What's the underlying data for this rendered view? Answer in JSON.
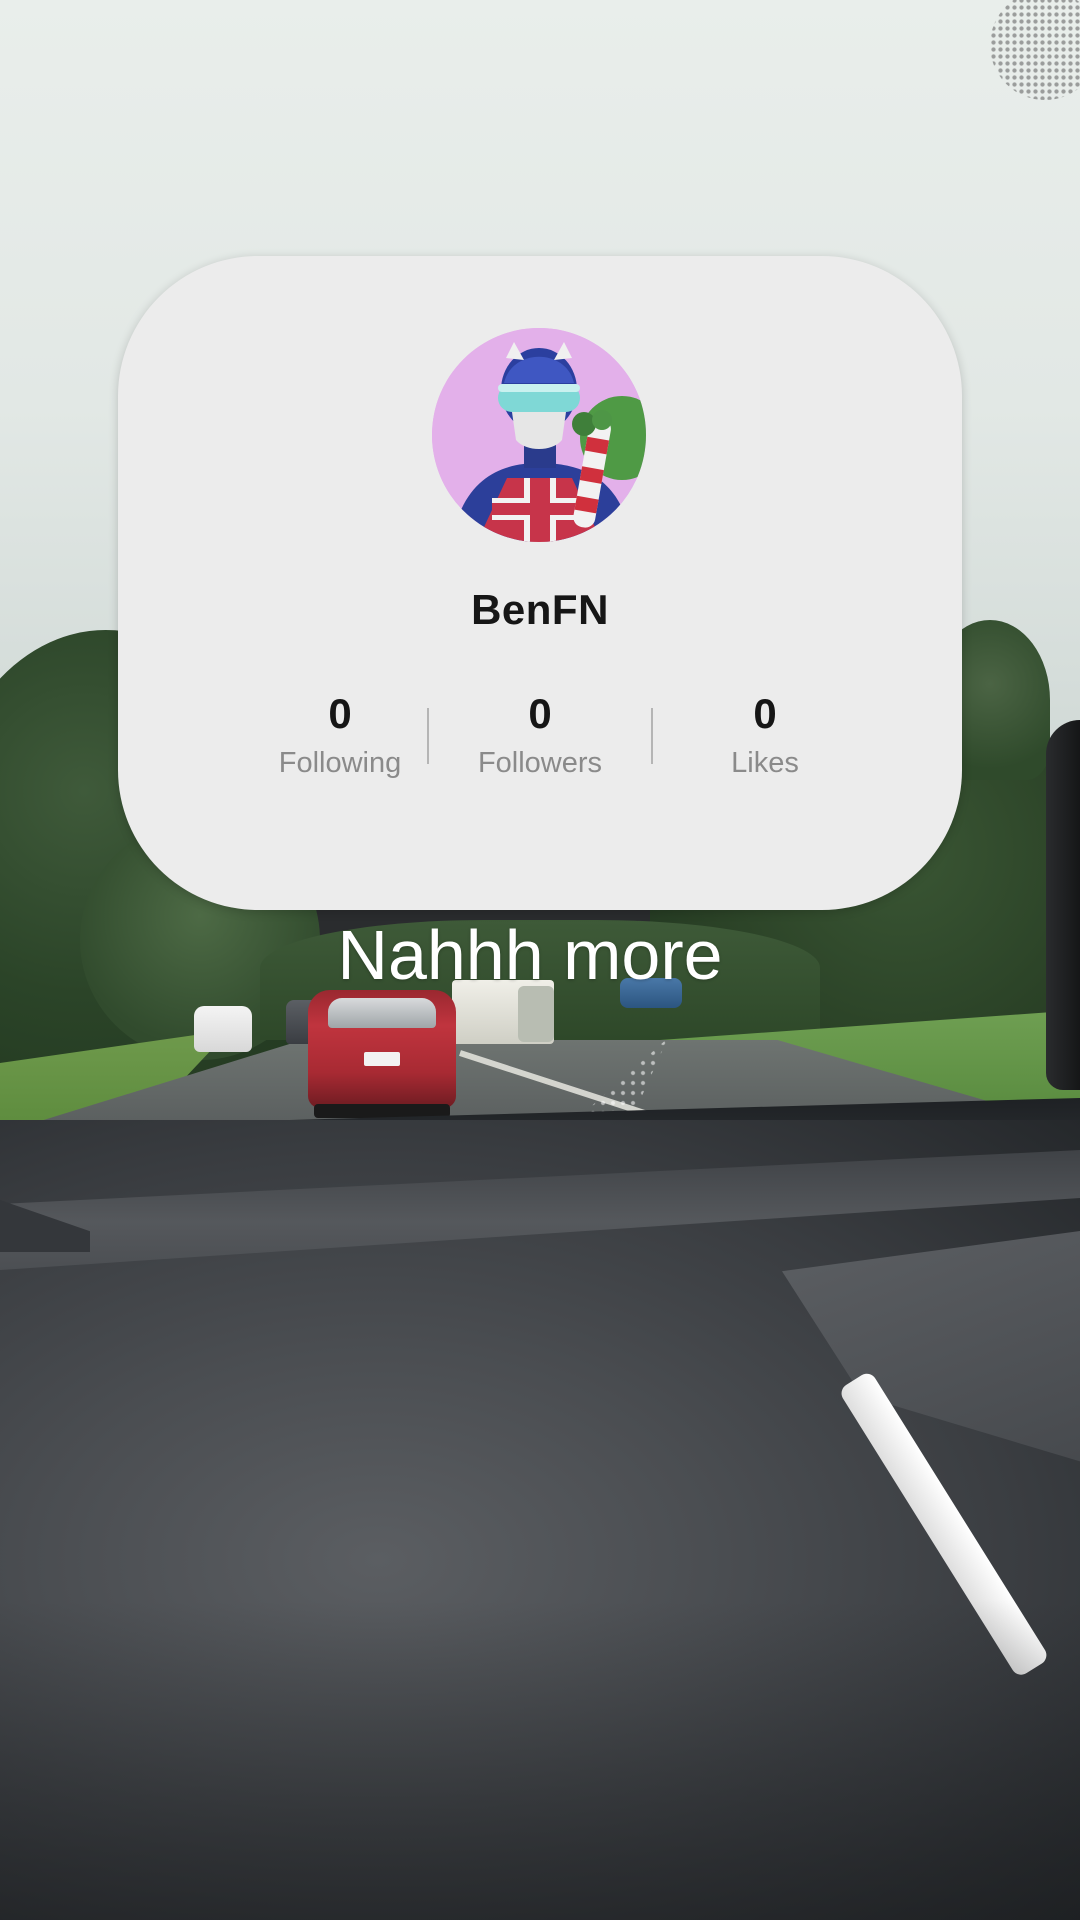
{
  "profile": {
    "username": "BenFN",
    "stats": [
      {
        "value": "0",
        "label": "Following"
      },
      {
        "value": "0",
        "label": "Followers"
      },
      {
        "value": "0",
        "label": "Likes"
      }
    ]
  },
  "caption": "Nahhh more",
  "colors": {
    "card_background": "#ececec",
    "primary_text": "#161616",
    "secondary_text": "#8a8a8a",
    "caption_text": "#ffffff"
  }
}
